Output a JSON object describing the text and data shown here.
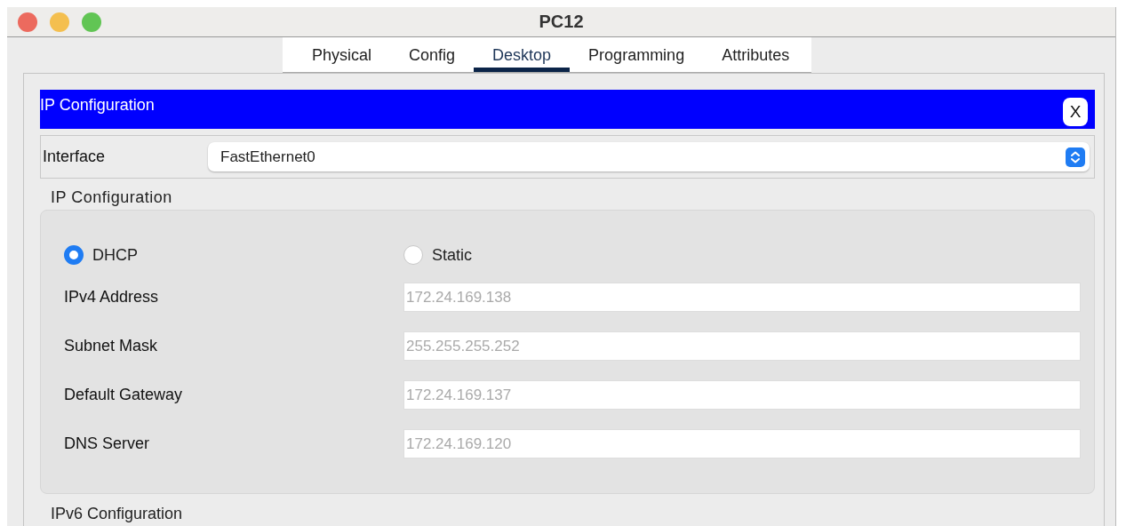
{
  "window": {
    "title": "PC12"
  },
  "tabs": [
    {
      "label": "Physical",
      "selected": false
    },
    {
      "label": "Config",
      "selected": false
    },
    {
      "label": "Desktop",
      "selected": true
    },
    {
      "label": "Programming",
      "selected": false
    },
    {
      "label": "Attributes",
      "selected": false
    }
  ],
  "app": {
    "title": "IP Configuration",
    "close": "X"
  },
  "interface": {
    "label": "Interface",
    "value": "FastEthernet0"
  },
  "ipv4": {
    "title": "IP Configuration",
    "modes": [
      {
        "label": "DHCP",
        "selected": true
      },
      {
        "label": "Static",
        "selected": false
      }
    ],
    "fields": [
      {
        "label": "IPv4 Address",
        "value": "172.24.169.138"
      },
      {
        "label": "Subnet Mask",
        "value": "255.255.255.252"
      },
      {
        "label": "Default Gateway",
        "value": "172.24.169.137"
      },
      {
        "label": "DNS Server",
        "value": "172.24.169.120"
      }
    ]
  },
  "ipv6": {
    "title": "IPv6 Configuration"
  }
}
